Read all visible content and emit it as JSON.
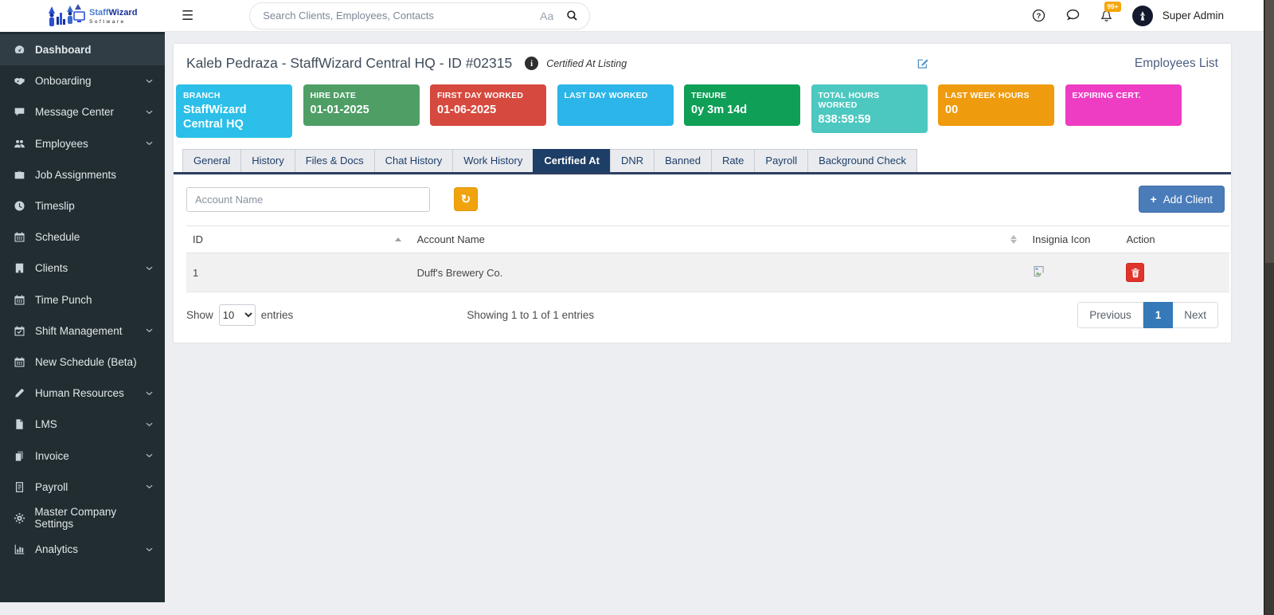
{
  "header": {
    "logo_text_primary": "Staff",
    "logo_text_secondary": "Wizard",
    "logo_subtext": "Software",
    "menu_icon": "☰",
    "search_placeholder": "Search Clients, Employees, Contacts",
    "font_size_toggle": "Aa",
    "notification_count": "99+",
    "user_name": "Super Admin"
  },
  "icons": {
    "menu": "☰",
    "refresh": "↻",
    "search": "magnifier",
    "help": "question-circle",
    "messages": "chat-bubble",
    "notifications": "bell",
    "edit": "pencil-square",
    "delete": "trash",
    "insignia_placeholder": "broken-image"
  },
  "sidebar": {
    "items": [
      {
        "label": "Dashboard",
        "icon": "dashboard-icon",
        "active": true,
        "expandable": false
      },
      {
        "label": "Onboarding",
        "icon": "handshake-icon",
        "active": false,
        "expandable": true
      },
      {
        "label": "Message Center",
        "icon": "chat-icon",
        "active": false,
        "expandable": true
      },
      {
        "label": "Employees",
        "icon": "users-icon",
        "active": false,
        "expandable": true
      },
      {
        "label": "Job Assignments",
        "icon": "briefcase-icon",
        "active": false,
        "expandable": false
      },
      {
        "label": "Timeslip",
        "icon": "clock-icon",
        "active": false,
        "expandable": false
      },
      {
        "label": "Schedule",
        "icon": "calendar-icon",
        "active": false,
        "expandable": false
      },
      {
        "label": "Clients",
        "icon": "building-icon",
        "active": false,
        "expandable": true
      },
      {
        "label": "Time Punch",
        "icon": "calendar-icon",
        "active": false,
        "expandable": false
      },
      {
        "label": "Shift Management",
        "icon": "calendar-check-icon",
        "active": false,
        "expandable": true
      },
      {
        "label": "New Schedule (Beta)",
        "icon": "calendar-icon",
        "active": false,
        "expandable": false
      },
      {
        "label": "Human Resources",
        "icon": "pencil-icon",
        "active": false,
        "expandable": true
      },
      {
        "label": "LMS",
        "icon": "file-icon",
        "active": false,
        "expandable": true
      },
      {
        "label": "Invoice",
        "icon": "copy-icon",
        "active": false,
        "expandable": true
      },
      {
        "label": "Payroll",
        "icon": "file-text-icon",
        "active": false,
        "expandable": true
      },
      {
        "label": "Master Company Settings",
        "icon": "gears-icon",
        "active": false,
        "expandable": false
      },
      {
        "label": "Analytics",
        "icon": "chart-icon",
        "active": false,
        "expandable": true
      }
    ]
  },
  "page": {
    "title": "Kaleb Pedraza - StaffWizard Central HQ - ID #02315",
    "subtitle": "Certified At Listing",
    "header_link": "Employees List"
  },
  "stat_cards": [
    {
      "label": "BRANCH",
      "value": "StaffWizard Central HQ",
      "color": "#2bbfe9"
    },
    {
      "label": "HIRE DATE",
      "value": "01-01-2025",
      "color": "#4e9e66"
    },
    {
      "label": "FIRST DAY WORKED",
      "value": "01-06-2025",
      "color": "#d6493e"
    },
    {
      "label": "LAST DAY WORKED",
      "value": "",
      "color": "#2bb5e9"
    },
    {
      "label": "TENURE",
      "value": "0y 3m 14d",
      "color": "#0f9f57"
    },
    {
      "label": "TOTAL HOURS WORKED",
      "value": "838:59:59",
      "color": "#4cc8c0"
    },
    {
      "label": "LAST WEEK HOURS",
      "value": "00",
      "color": "#ef9b0e"
    },
    {
      "label": "EXPIRING CERT.",
      "value": "",
      "color": "#ee3cc3"
    }
  ],
  "tabs": [
    {
      "label": "General",
      "active": false
    },
    {
      "label": "History",
      "active": false
    },
    {
      "label": "Files & Docs",
      "active": false
    },
    {
      "label": "Chat History",
      "active": false
    },
    {
      "label": "Work History",
      "active": false
    },
    {
      "label": "Certified At",
      "active": true
    },
    {
      "label": "DNR",
      "active": false
    },
    {
      "label": "Banned",
      "active": false
    },
    {
      "label": "Rate",
      "active": false
    },
    {
      "label": "Payroll",
      "active": false
    },
    {
      "label": "Background Check",
      "active": false
    }
  ],
  "toolbar": {
    "filter_placeholder": "Account Name",
    "refresh_glyph": "↻",
    "add_client_plus": "+",
    "add_client_label": "Add Client"
  },
  "table": {
    "columns": [
      {
        "label": "ID",
        "sort": "asc"
      },
      {
        "label": "Account Name",
        "sort": "both"
      },
      {
        "label": "Insignia Icon",
        "sort": "none"
      },
      {
        "label": "Action",
        "sort": "none"
      }
    ],
    "rows": [
      {
        "id": "1",
        "account_name": "Duff's Brewery Co."
      }
    ]
  },
  "footer": {
    "show_label": "Show",
    "page_size": "10",
    "entries_label": "entries",
    "showing_text": "Showing 1 to 1 of 1 entries",
    "previous_label": "Previous",
    "current_page": "1",
    "next_label": "Next"
  }
}
